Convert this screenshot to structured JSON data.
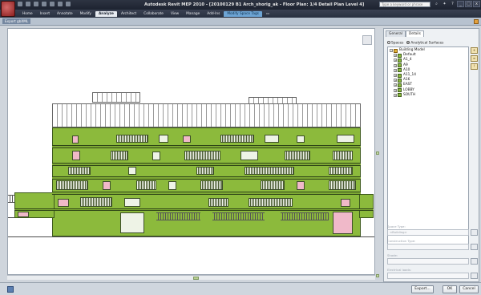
{
  "window": {
    "title": "Autodesk Revit MEP 2010 - [20100129 B1 Arch_shorig_ak - Floor Plan: 1/4 Detail Plan Level 4]",
    "search_placeholder": "Type a keyword or phrase",
    "controls": [
      "_",
      "□",
      "x"
    ]
  },
  "ribbon": {
    "tabs": [
      {
        "label": "Home"
      },
      {
        "label": "Insert"
      },
      {
        "label": "Annotate"
      },
      {
        "label": "Modify"
      },
      {
        "label": "Analyze",
        "active": true
      },
      {
        "label": "Architect"
      },
      {
        "label": "Collaborate"
      },
      {
        "label": "View"
      },
      {
        "label": "Manage"
      },
      {
        "label": "Add-Ins"
      },
      {
        "label": "Modify Space Tags",
        "contextual": true
      }
    ]
  },
  "viewbar": {
    "label": "Export gbXML"
  },
  "panel": {
    "tabs": [
      "General",
      "Details"
    ],
    "active_tab": "Details",
    "radio_spaces": "Spaces",
    "radio_surfaces": "Analytical Surfaces",
    "selected_radio": "Analytical Surfaces",
    "tree": {
      "root": "Building Model",
      "children": [
        "Default",
        "A1_4",
        "A9",
        "A10",
        "A11_14",
        "A16",
        "EAST",
        "LOBBY",
        "SOUTH"
      ]
    },
    "fields": [
      {
        "label": "Space Type:",
        "value": "<Building>"
      },
      {
        "label": "Construction Type:",
        "value": ""
      },
      {
        "label": "Shade:",
        "value": ""
      },
      {
        "label": "Electrical loads:",
        "value": ""
      }
    ]
  },
  "buttons": {
    "export": "Export...",
    "ok": "OK",
    "cancel": "Cancel"
  },
  "colors": {
    "surface_green": "#8cba3c",
    "opening_pink": "#f0b9c9",
    "titlebar": "#2d3442"
  }
}
